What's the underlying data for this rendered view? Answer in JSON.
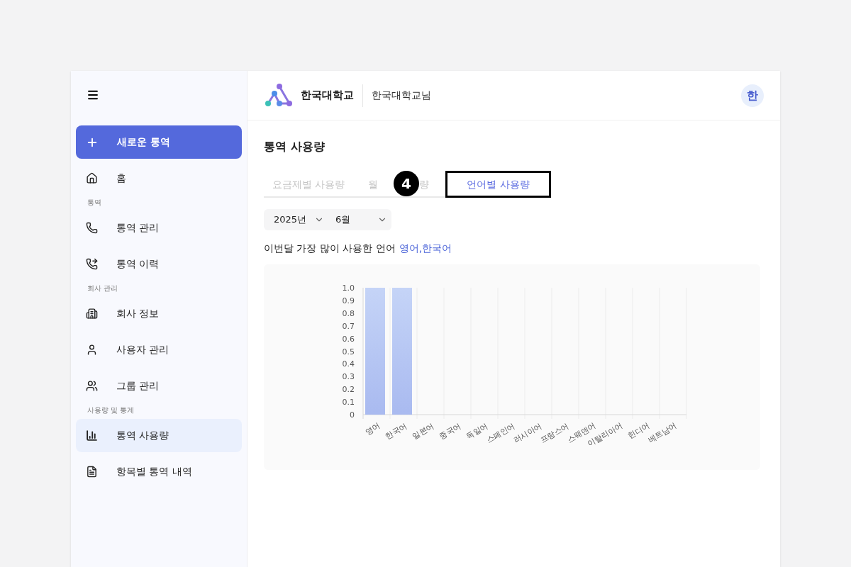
{
  "sidebar": {
    "new_button": "새로운 통역",
    "items": [
      {
        "kind": "item",
        "label": "홈",
        "selected": false
      },
      {
        "kind": "section",
        "label": "통역"
      },
      {
        "kind": "item",
        "label": "통역 관리",
        "selected": false
      },
      {
        "kind": "item",
        "label": "통역 이력",
        "selected": false
      },
      {
        "kind": "section",
        "label": "회사 관리"
      },
      {
        "kind": "item",
        "label": "회사 정보",
        "selected": false
      },
      {
        "kind": "item",
        "label": "사용자 관리",
        "selected": false
      },
      {
        "kind": "item",
        "label": "그룹 관리",
        "selected": false
      },
      {
        "kind": "section",
        "label": "사용량 및 통계"
      },
      {
        "kind": "item",
        "label": "통역 사용량",
        "selected": true
      },
      {
        "kind": "item",
        "label": "항목별 통역 내역",
        "selected": false
      }
    ]
  },
  "header": {
    "org": "한국대학교",
    "user": "한국대학교님",
    "avatar": "한"
  },
  "page_title": "통역 사용량",
  "tabs": [
    {
      "label": "요금제별 사용량",
      "selected": false,
      "highlighted": false
    },
    {
      "label_parts": [
        "월",
        "량"
      ],
      "selected": false,
      "highlighted": false
    },
    {
      "label": "언어별 사용량",
      "selected": true,
      "highlighted": true
    }
  ],
  "step_badge": "4",
  "filters": {
    "year": "2025년",
    "month": "6월"
  },
  "summary": {
    "text": "이번달 가장 많이 사용한 언어",
    "value": "영어,한국어"
  },
  "chart_data": {
    "type": "bar",
    "categories": [
      "영어",
      "한국어",
      "일본어",
      "중국어",
      "독일어",
      "스페인어",
      "러시아어",
      "프랑스어",
      "스웨덴어",
      "이탈리아어",
      "힌디어",
      "베트남어"
    ],
    "values": [
      1,
      1,
      0,
      0,
      0,
      0,
      0,
      0,
      0,
      0,
      0,
      0
    ],
    "ylim": [
      0,
      1
    ],
    "yticks": [
      {
        "value": 0,
        "label": "0"
      },
      0.1,
      0.2,
      0.3,
      0.4,
      0.5,
      0.6,
      0.7,
      0.8,
      0.9,
      {
        "value": 1,
        "label": "1.0"
      }
    ]
  }
}
